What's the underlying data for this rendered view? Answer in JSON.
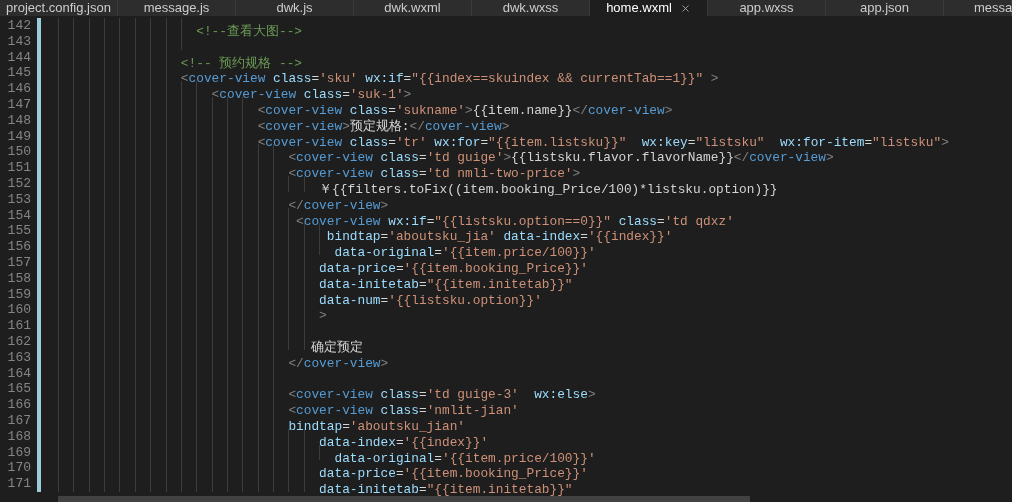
{
  "tabs": [
    {
      "label": "project.config.json",
      "selected": false
    },
    {
      "label": "message.js",
      "selected": false
    },
    {
      "label": "dwk.js",
      "selected": false
    },
    {
      "label": "dwk.wxml",
      "selected": false
    },
    {
      "label": "dwk.wxss",
      "selected": false
    },
    {
      "label": "home.wxml",
      "selected": true
    },
    {
      "label": "app.wxss",
      "selected": false
    },
    {
      "label": "app.json",
      "selected": false
    },
    {
      "label": "messa",
      "selected": false
    }
  ],
  "lines": [
    {
      "number": "142",
      "tokens": [
        {
          "kind": "comment",
          "text": "                  <!--查看大图-->"
        }
      ]
    },
    {
      "number": "143"
    },
    {
      "number": "144",
      "tokens": [
        {
          "kind": "comment",
          "text": "                <!-- 预约规格 -->"
        }
      ]
    },
    {
      "number": "145",
      "tokens": [
        {
          "kind": "punct",
          "text": "                <"
        },
        {
          "kind": "tag",
          "text": "cover-view"
        },
        {
          "kind": "attr",
          "text": " class"
        },
        {
          "kind": "text",
          "text": "="
        },
        {
          "kind": "string",
          "text": "'sku'"
        },
        {
          "kind": "attr",
          "text": " wx:if"
        },
        {
          "kind": "text",
          "text": "="
        },
        {
          "kind": "string",
          "text": "\"{{index==skuindex && currentTab==1}}\""
        },
        {
          "kind": "punct",
          "text": " >"
        }
      ]
    },
    {
      "number": "146",
      "tokens": [
        {
          "kind": "punct",
          "text": "                    <"
        },
        {
          "kind": "tag",
          "text": "cover-view"
        },
        {
          "kind": "attr",
          "text": " class"
        },
        {
          "kind": "text",
          "text": "="
        },
        {
          "kind": "string",
          "text": "'suk-1'"
        },
        {
          "kind": "punct",
          "text": ">"
        }
      ]
    },
    {
      "number": "147",
      "tokens": [
        {
          "kind": "punct",
          "text": "                          <"
        },
        {
          "kind": "tag",
          "text": "cover-view"
        },
        {
          "kind": "attr",
          "text": " class"
        },
        {
          "kind": "text",
          "text": "="
        },
        {
          "kind": "string",
          "text": "'sukname'"
        },
        {
          "kind": "punct",
          "text": ">"
        },
        {
          "kind": "text",
          "text": "{{item.name}}"
        },
        {
          "kind": "punct",
          "text": "</"
        },
        {
          "kind": "tag",
          "text": "cover-view"
        },
        {
          "kind": "punct",
          "text": ">"
        }
      ]
    },
    {
      "number": "148",
      "tokens": [
        {
          "kind": "punct",
          "text": "                          <"
        },
        {
          "kind": "tag",
          "text": "cover-view"
        },
        {
          "kind": "punct",
          "text": ">"
        },
        {
          "kind": "text",
          "text": "预定规格:"
        },
        {
          "kind": "punct",
          "text": "</"
        },
        {
          "kind": "tag",
          "text": "cover-view"
        },
        {
          "kind": "punct",
          "text": ">"
        }
      ]
    },
    {
      "number": "149",
      "tokens": [
        {
          "kind": "punct",
          "text": "                          <"
        },
        {
          "kind": "tag",
          "text": "cover-view"
        },
        {
          "kind": "attr",
          "text": " class"
        },
        {
          "kind": "text",
          "text": "="
        },
        {
          "kind": "string",
          "text": "'tr'"
        },
        {
          "kind": "attr",
          "text": " wx:for"
        },
        {
          "kind": "text",
          "text": "="
        },
        {
          "kind": "string",
          "text": "\"{{item.listsku}}\""
        },
        {
          "kind": "attr",
          "text": "  wx:key"
        },
        {
          "kind": "text",
          "text": "="
        },
        {
          "kind": "string",
          "text": "\"listsku\""
        },
        {
          "kind": "attr",
          "text": "  wx:for-item"
        },
        {
          "kind": "text",
          "text": "="
        },
        {
          "kind": "string",
          "text": "\"listsku\""
        },
        {
          "kind": "punct",
          "text": ">"
        }
      ]
    },
    {
      "number": "150",
      "tokens": [
        {
          "kind": "punct",
          "text": "                              <"
        },
        {
          "kind": "tag",
          "text": "cover-view"
        },
        {
          "kind": "attr",
          "text": " class"
        },
        {
          "kind": "text",
          "text": "="
        },
        {
          "kind": "string",
          "text": "'td guige'"
        },
        {
          "kind": "punct",
          "text": ">"
        },
        {
          "kind": "text",
          "text": "{{listsku.flavor.flavorName}}"
        },
        {
          "kind": "punct",
          "text": "</"
        },
        {
          "kind": "tag",
          "text": "cover-view"
        },
        {
          "kind": "punct",
          "text": ">"
        }
      ]
    },
    {
      "number": "151",
      "tokens": [
        {
          "kind": "punct",
          "text": "                              <"
        },
        {
          "kind": "tag",
          "text": "cover-view"
        },
        {
          "kind": "attr",
          "text": " class"
        },
        {
          "kind": "text",
          "text": "="
        },
        {
          "kind": "string",
          "text": "'td nmli-two-price'"
        },
        {
          "kind": "punct",
          "text": ">"
        }
      ]
    },
    {
      "number": "152",
      "tokens": [
        {
          "kind": "text",
          "text": "                                  ￥{{filters.toFix((item.booking_Price/100)*listsku.option)}}"
        }
      ]
    },
    {
      "number": "153",
      "tokens": [
        {
          "kind": "punct",
          "text": "                              </"
        },
        {
          "kind": "tag",
          "text": "cover-view"
        },
        {
          "kind": "punct",
          "text": ">"
        }
      ]
    },
    {
      "number": "154",
      "tokens": [
        {
          "kind": "punct",
          "text": "                               <"
        },
        {
          "kind": "tag",
          "text": "cover-view"
        },
        {
          "kind": "attr",
          "text": " wx:if"
        },
        {
          "kind": "text",
          "text": "="
        },
        {
          "kind": "string",
          "text": "\"{{listsku.option==0}}\""
        },
        {
          "kind": "attr",
          "text": " class"
        },
        {
          "kind": "text",
          "text": "="
        },
        {
          "kind": "string",
          "text": "'td qdxz'"
        }
      ]
    },
    {
      "number": "155",
      "tokens": [
        {
          "kind": "attr",
          "text": "                                   bindtap"
        },
        {
          "kind": "text",
          "text": "="
        },
        {
          "kind": "string",
          "text": "'aboutsku_jia'"
        },
        {
          "kind": "attr",
          "text": " data-index"
        },
        {
          "kind": "text",
          "text": "="
        },
        {
          "kind": "string",
          "text": "'{{index}}'"
        }
      ]
    },
    {
      "number": "156",
      "tokens": [
        {
          "kind": "attr",
          "text": "                                    data-original"
        },
        {
          "kind": "text",
          "text": "="
        },
        {
          "kind": "string",
          "text": "'{{item.price/100}}'"
        }
      ]
    },
    {
      "number": "157",
      "tokens": [
        {
          "kind": "attr",
          "text": "                                  data-price"
        },
        {
          "kind": "text",
          "text": "="
        },
        {
          "kind": "string",
          "text": "'{{item.booking_Price}}'"
        }
      ]
    },
    {
      "number": "158",
      "tokens": [
        {
          "kind": "attr",
          "text": "                                  data-initetab"
        },
        {
          "kind": "text",
          "text": "="
        },
        {
          "kind": "string",
          "text": "\"{{item.initetab}}\""
        }
      ]
    },
    {
      "number": "159",
      "tokens": [
        {
          "kind": "attr",
          "text": "                                  data-num"
        },
        {
          "kind": "text",
          "text": "="
        },
        {
          "kind": "string",
          "text": "'{{listsku.option}}'"
        }
      ]
    },
    {
      "number": "160",
      "tokens": [
        {
          "kind": "punct",
          "text": "                                  >"
        }
      ]
    },
    {
      "number": "161"
    },
    {
      "number": "162",
      "tokens": [
        {
          "kind": "text",
          "text": "                                 确定预定"
        }
      ]
    },
    {
      "number": "163",
      "tokens": [
        {
          "kind": "punct",
          "text": "                              </"
        },
        {
          "kind": "tag",
          "text": "cover-view"
        },
        {
          "kind": "punct",
          "text": ">"
        }
      ]
    },
    {
      "number": "164"
    },
    {
      "number": "165",
      "tokens": [
        {
          "kind": "punct",
          "text": "                              <"
        },
        {
          "kind": "tag",
          "text": "cover-view"
        },
        {
          "kind": "attr",
          "text": " class"
        },
        {
          "kind": "text",
          "text": "="
        },
        {
          "kind": "string",
          "text": "'td guige-3'"
        },
        {
          "kind": "attr",
          "text": "  wx:else"
        },
        {
          "kind": "punct",
          "text": ">"
        }
      ]
    },
    {
      "number": "166",
      "tokens": [
        {
          "kind": "punct",
          "text": "                              <"
        },
        {
          "kind": "tag",
          "text": "cover-view"
        },
        {
          "kind": "attr",
          "text": " class"
        },
        {
          "kind": "text",
          "text": "="
        },
        {
          "kind": "string",
          "text": "'nmlit-jian'"
        }
      ]
    },
    {
      "number": "167",
      "tokens": [
        {
          "kind": "attr",
          "text": "                              bindtap"
        },
        {
          "kind": "text",
          "text": "="
        },
        {
          "kind": "string",
          "text": "'aboutsku_jian'"
        }
      ]
    },
    {
      "number": "168",
      "tokens": [
        {
          "kind": "attr",
          "text": "                                  data-index"
        },
        {
          "kind": "text",
          "text": "="
        },
        {
          "kind": "string",
          "text": "'{{index}}'"
        }
      ]
    },
    {
      "number": "169",
      "tokens": [
        {
          "kind": "attr",
          "text": "                                    data-original"
        },
        {
          "kind": "text",
          "text": "="
        },
        {
          "kind": "string",
          "text": "'{{item.price/100}}'"
        }
      ]
    },
    {
      "number": "170",
      "tokens": [
        {
          "kind": "attr",
          "text": "                                  data-price"
        },
        {
          "kind": "text",
          "text": "="
        },
        {
          "kind": "string",
          "text": "'{{item.booking_Price}}'"
        }
      ]
    },
    {
      "number": "171",
      "tokens": [
        {
          "kind": "attr",
          "text": "                                  data-initetab"
        },
        {
          "kind": "text",
          "text": "="
        },
        {
          "kind": "string",
          "text": "\"{{item.initetab}}\""
        }
      ]
    }
  ]
}
